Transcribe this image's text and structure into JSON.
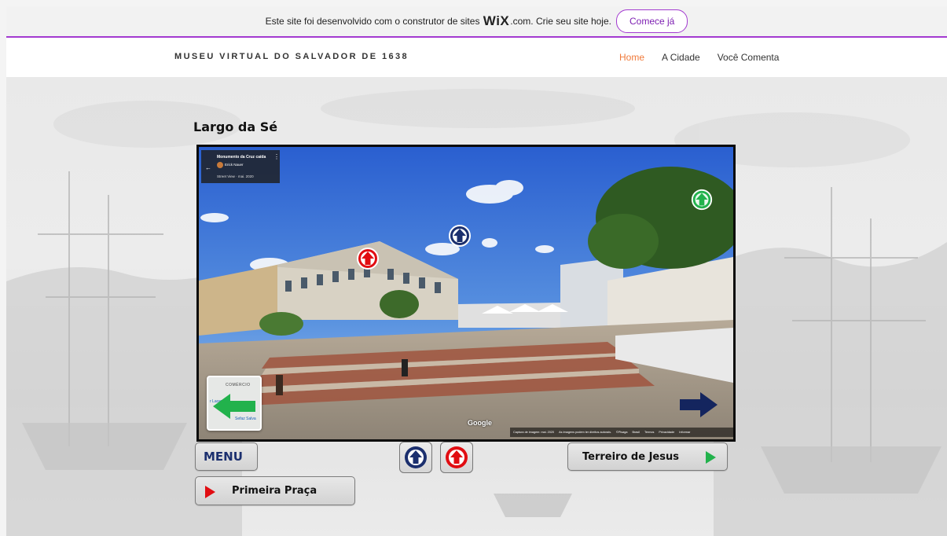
{
  "wix_banner": {
    "prefix": "Este site foi desenvolvido com o construtor de sites",
    "brand": "WiX",
    "suffix": ".com. Crie seu site hoje.",
    "cta": "Comece já",
    "accent": "#a33ad0"
  },
  "site": {
    "title": "MUSEU VIRTUAL DO SALVADOR DE 1638",
    "nav": [
      {
        "label": "Home",
        "active": true
      },
      {
        "label": "A Cidade",
        "active": false
      },
      {
        "label": "Você Comenta",
        "active": false
      }
    ],
    "nav_active_color": "#f07a3a"
  },
  "page": {
    "heading": "Largo da Sé"
  },
  "streetview": {
    "place_title": "Monumento da Cruz caída",
    "author": "Erick Nauer",
    "capture": "Street View · mai. 2020",
    "minimap_labels": [
      "COMÉRCIO",
      "r Lacer",
      "Sefaz Salva"
    ],
    "google": "Google",
    "footer": [
      "Captura de imagem: mai. 2020",
      "As imagens podem ter direitos autorais.",
      "©Pisaga",
      "Brasil",
      "Termos",
      "Privacidade",
      "Informar"
    ]
  },
  "hotspots": [
    {
      "name": "red-up-arrow",
      "color": "#e10d12"
    },
    {
      "name": "blue-up-arrow",
      "color": "#1b2f6e"
    },
    {
      "name": "green-up-arrow",
      "color": "#22b24c"
    },
    {
      "name": "green-left-arrow",
      "color": "#22b24c"
    },
    {
      "name": "navy-right-arrow",
      "color": "#14255e"
    }
  ],
  "buttons": {
    "menu": "MENU",
    "next": "Terreiro de Jesus",
    "prev": "Primeira Praça",
    "up_blue_color": "#1b2f6e",
    "up_red_color": "#e10d12"
  }
}
